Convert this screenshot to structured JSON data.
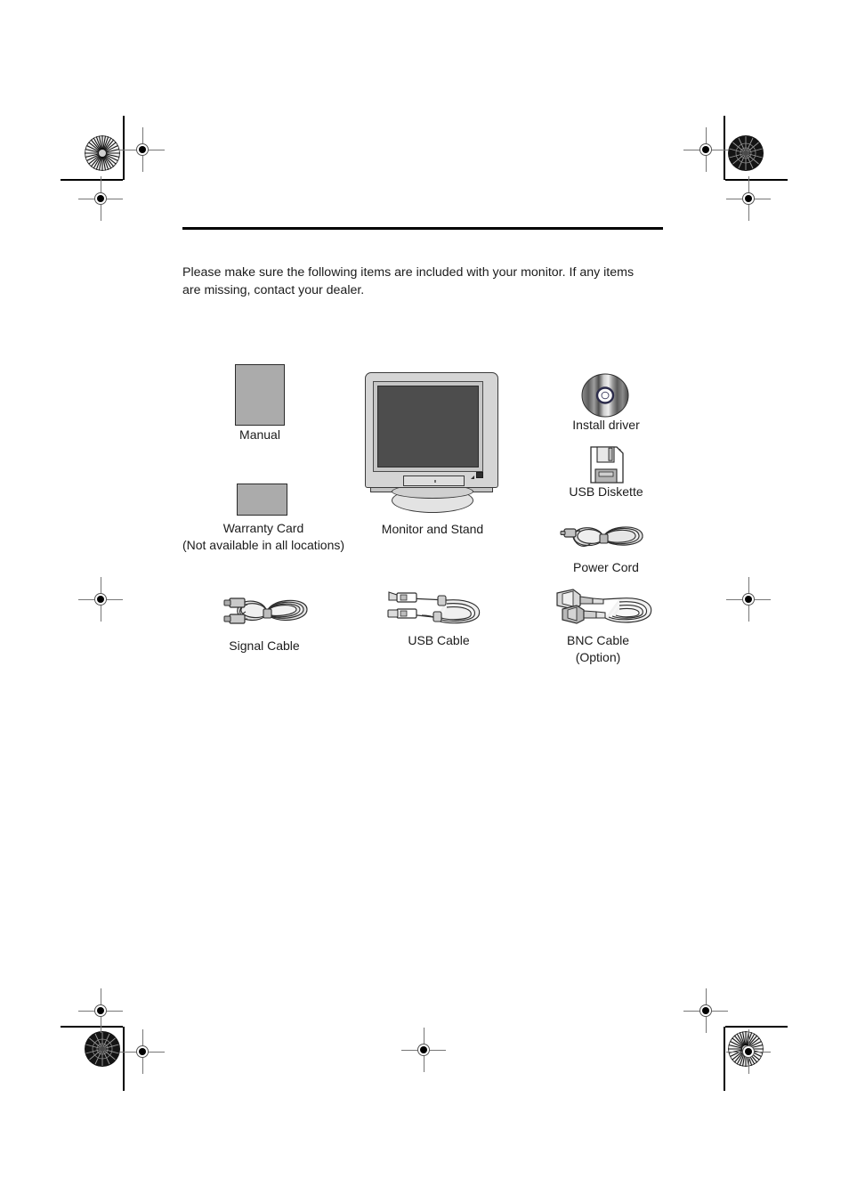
{
  "document": {
    "intro_text": "Please make sure the following items are included with your monitor. If any items are missing, contact your dealer."
  },
  "items": [
    {
      "id": "manual",
      "label": "Manual"
    },
    {
      "id": "warranty-card",
      "label": "Warranty Card\n(Not available in all locations)"
    },
    {
      "id": "monitor-stand",
      "label": "Monitor and Stand"
    },
    {
      "id": "install-driver",
      "label": "Install driver"
    },
    {
      "id": "usb-diskette",
      "label": "USB Diskette"
    },
    {
      "id": "power-cord",
      "label": "Power Cord"
    },
    {
      "id": "signal-cable",
      "label": "Signal Cable"
    },
    {
      "id": "usb-cable",
      "label": "USB Cable"
    },
    {
      "id": "bnc-cable",
      "label": "BNC Cable\n(Option)"
    }
  ],
  "colors": {
    "paper_gray": "#ababab",
    "screen_gray": "#4d4d4d",
    "monitor_body": "#d5d5d5",
    "rule_black": "#000000",
    "text": "#1b1b1b"
  }
}
